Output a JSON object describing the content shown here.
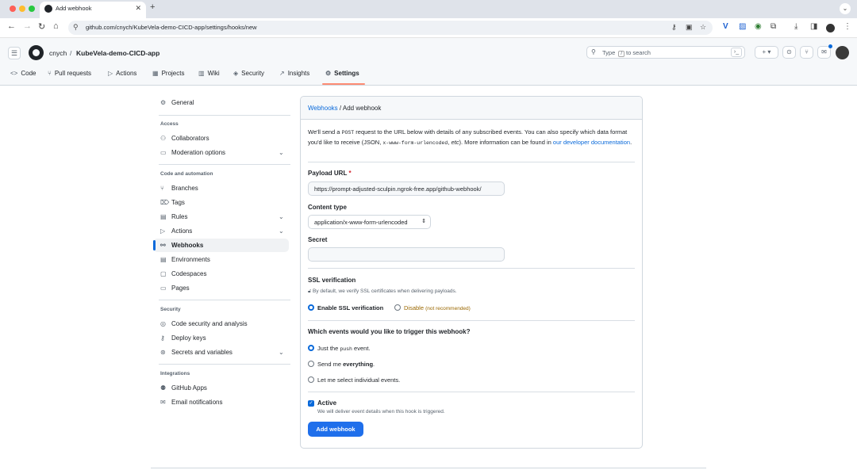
{
  "browser": {
    "tab_title": "Add webhook",
    "url": "github.com/cnych/KubeVela-demo-CICD-app/settings/hooks/new"
  },
  "header": {
    "owner": "cnych",
    "separator": "/",
    "repo": "KubeVela-demo-CICD-app",
    "search_prefix": "Type",
    "search_key": "/",
    "search_suffix": "to search",
    "plus_label": "+ ▾"
  },
  "repo_nav": [
    {
      "icon": "<>",
      "label": "Code"
    },
    {
      "icon": "⑂",
      "label": "Pull requests"
    },
    {
      "icon": "▷",
      "label": "Actions"
    },
    {
      "icon": "▦",
      "label": "Projects"
    },
    {
      "icon": "▥",
      "label": "Wiki"
    },
    {
      "icon": "◈",
      "label": "Security"
    },
    {
      "icon": "↗",
      "label": "Insights"
    },
    {
      "icon": "⚙",
      "label": "Settings"
    }
  ],
  "sidebar": {
    "general": "General",
    "access_heading": "Access",
    "collaborators": "Collaborators",
    "moderation": "Moderation options",
    "code_heading": "Code and automation",
    "branches": "Branches",
    "tags": "Tags",
    "rules": "Rules",
    "actions": "Actions",
    "webhooks": "Webhooks",
    "environments": "Environments",
    "codespaces": "Codespaces",
    "pages": "Pages",
    "security_heading": "Security",
    "code_security": "Code security and analysis",
    "deploy_keys": "Deploy keys",
    "secrets": "Secrets and variables",
    "integrations_heading": "Integrations",
    "github_apps": "GitHub Apps",
    "email_notifications": "Email notifications"
  },
  "form": {
    "breadcrumb_link": "Webhooks",
    "breadcrumb_sep": " / ",
    "breadcrumb_current": "Add webhook",
    "intro_1": "We'll send a ",
    "intro_post": "POST",
    "intro_2": " request to the URL below with details of any subscribed events. You can also specify which data format you'd like to receive (JSON, ",
    "intro_code": "x-www-form-urlencoded",
    "intro_3": ", ",
    "intro_etc": "etc",
    "intro_4": "). More information can be found in ",
    "intro_link": "our developer documentation",
    "intro_5": ".",
    "payload_label": "Payload URL",
    "payload_required": "*",
    "payload_value": "https://prompt-adjusted-sculpin.ngrok-free.app/github-webhook/",
    "content_type_label": "Content type",
    "content_type_value": "application/x-www-form-urlencoded",
    "secret_label": "Secret",
    "secret_value": "",
    "ssl_label": "SSL verification",
    "ssl_note": "By default, we verify SSL certificates when delivering payloads.",
    "ssl_enable": "Enable SSL verification",
    "ssl_disable": "Disable",
    "ssl_disable_note": "(not recommended)",
    "events_label": "Which events would you like to trigger this webhook?",
    "event_push_1": "Just the ",
    "event_push_code": "push",
    "event_push_2": " event.",
    "event_all_1": "Send me ",
    "event_all_bold": "everything",
    "event_all_2": ".",
    "event_individual": "Let me select individual events.",
    "active_label": "Active",
    "active_note": "We will deliver event details when this hook is triggered.",
    "submit": "Add webhook"
  }
}
